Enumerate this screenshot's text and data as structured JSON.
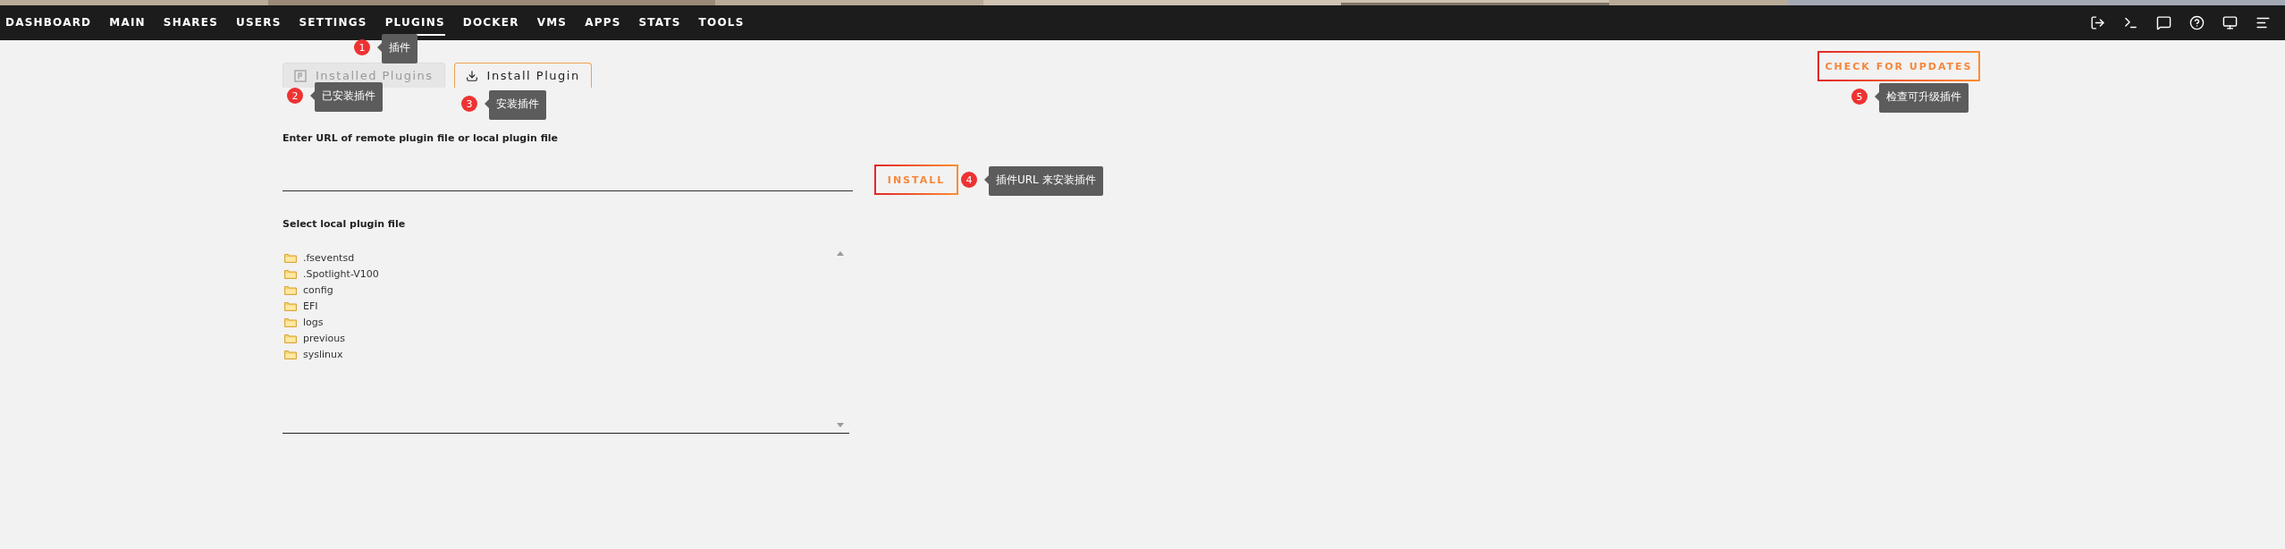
{
  "nav": {
    "items": [
      {
        "label": "DASHBOARD",
        "selected": false
      },
      {
        "label": "MAIN",
        "selected": false
      },
      {
        "label": "SHARES",
        "selected": false
      },
      {
        "label": "USERS",
        "selected": false
      },
      {
        "label": "SETTINGS",
        "selected": false
      },
      {
        "label": "PLUGINS",
        "selected": true
      },
      {
        "label": "DOCKER",
        "selected": false
      },
      {
        "label": "VMS",
        "selected": false
      },
      {
        "label": "APPS",
        "selected": false
      },
      {
        "label": "STATS",
        "selected": false
      },
      {
        "label": "TOOLS",
        "selected": false
      }
    ]
  },
  "tabs": [
    {
      "label": "Installed Plugins",
      "selected": false
    },
    {
      "label": "Install Plugin",
      "selected": true
    }
  ],
  "check_button": "CHECK FOR UPDATES",
  "url_field": {
    "label": "Enter URL of remote plugin file or local plugin file"
  },
  "install_button": "INSTALL",
  "file_picker": {
    "label": "Select local plugin file",
    "items": [
      ".fseventsd",
      ".Spotlight-V100",
      "config",
      "EFI",
      "logs",
      "previous",
      "syslinux"
    ]
  },
  "callouts": [
    {
      "number": "1",
      "text": "插件"
    },
    {
      "number": "2",
      "text": "已安装插件"
    },
    {
      "number": "3",
      "text": "安装插件"
    },
    {
      "number": "4",
      "text": "插件URL 来安装插件"
    },
    {
      "number": "5",
      "text": "检查可升级插件"
    }
  ]
}
